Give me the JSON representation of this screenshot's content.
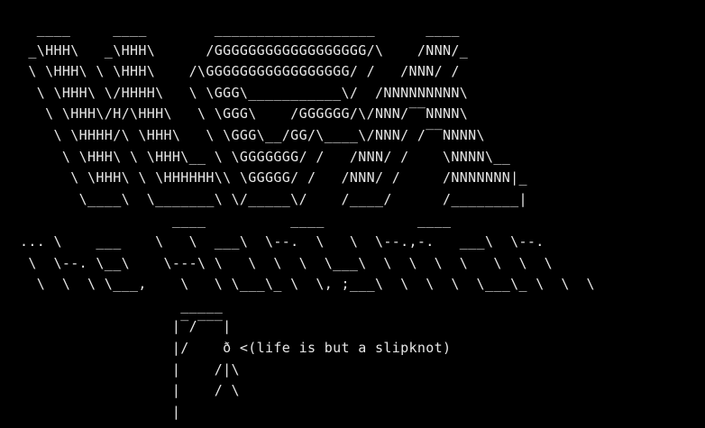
{
  "theme": {
    "background": "#000000",
    "foreground": "#e6e6e6"
  },
  "banner": {
    "lines": [
      "  ____     ____        ___________________      ____",
      " _\\HHH\\   _\\HHH\\      /GGGGGGGGGGGGGGGGGG/\\    /NNN/_",
      " \\ \\HHH\\ \\ \\HHH\\    /\\GGGGGGGGGGGGGGGGG/ /   /NNN/ /",
      "  \\ \\HHH\\ \\/HHHH\\   \\ \\GGG\\___________\\/  /NNNNNNNNN\\",
      "   \\ \\HHH\\/H/\\HHH\\   \\ \\GGG\\    /GGGGGG/\\/NNN/‾‾NNNN\\",
      "    \\ \\HHHH/\\ \\HHH\\   \\ \\GGG\\__/GG/\\____\\/NNN/ /‾‾NNNN\\",
      "     \\ \\HHH\\ \\ \\HHH\\__ \\ \\GGGGGGG/ /   /NNN/ /    \\NNNN\\__",
      "      \\ \\HHH\\ \\ \\HHHHHH\\\\ \\GGGGG/ /   /NNN/ /     /NNNNNNN|_",
      "       \\____\\  \\_______\\ \\/_____\\/    /____/      /________|"
    ]
  },
  "subtitle": {
    "lines": [
      "                  ____          ____           ____",
      "... \\    ___    \\   \\  ___\\  \\--.  \\   \\  \\--.,-.   ___\\  \\--.",
      " \\  \\--. \\__\\    \\---\\ \\   \\  \\  \\  \\___\\  \\  \\  \\  \\   \\  \\  \\",
      "  \\  \\  \\ \\___,    \\   \\ \\___\\_ \\  \\, ;___\\  \\  \\  \\  \\___\\_ \\  \\  \\"
    ]
  },
  "gallows": {
    "lines": [
      "                   _____",
      "                  |‾/‾‾‾|",
      "                  |/    ð <(life is but a slipknot)",
      "                  |    /|\\",
      "                  |    / \\",
      "                  |"
    ]
  }
}
